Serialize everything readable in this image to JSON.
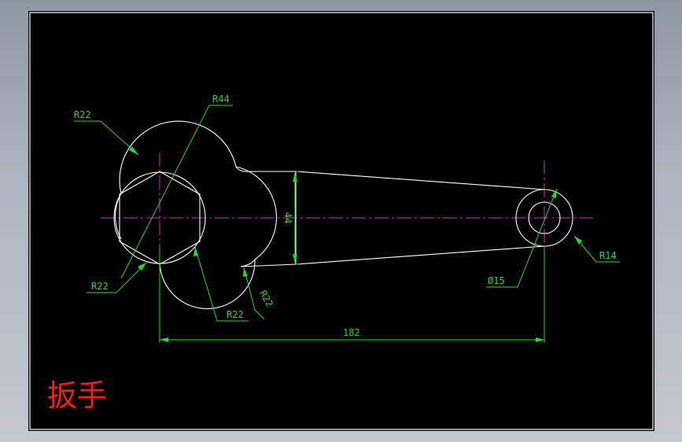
{
  "drawing": {
    "title": "扳手",
    "colors": {
      "background": "#000000",
      "outline": "#ffffff",
      "centerline": "#cc33cc",
      "dimension": "#22dd22",
      "border": "#ffffff",
      "title": "#ff1a1a"
    },
    "dimensions": {
      "r22_top": "R22",
      "r44": "R44",
      "h44": "44",
      "r22_left": "R22",
      "r22_bottom": "R22",
      "r22_neck": "R22",
      "d182": "182",
      "phi15": "Ø15",
      "r14": "R14"
    }
  }
}
